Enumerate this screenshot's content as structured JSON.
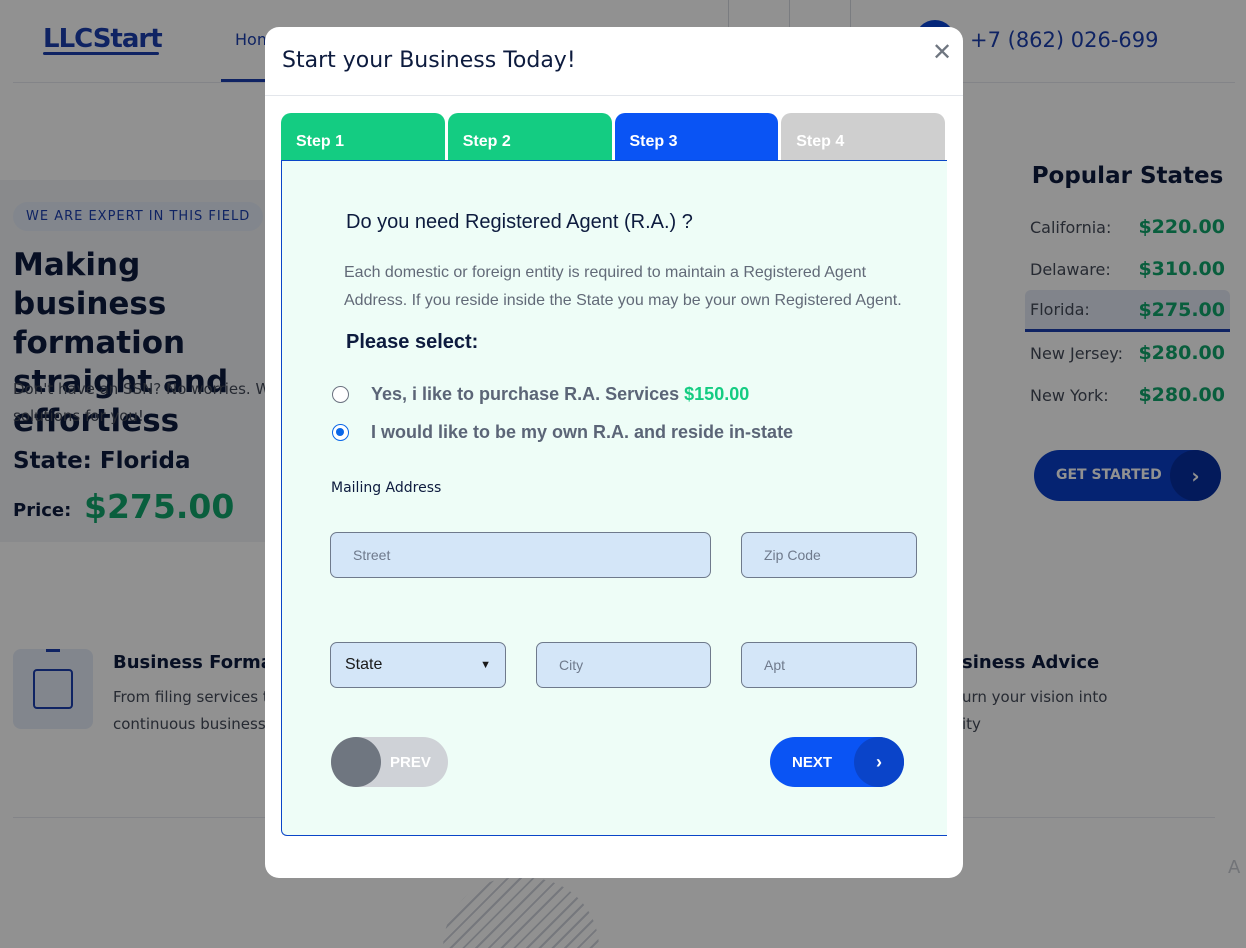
{
  "background": {
    "logo": "LLCStart",
    "nav_home": "Hom",
    "phone": "+7 (862) 026-699",
    "expert_badge": "WE ARE EXPERT IN THIS FIELD",
    "hero_title": "Making business formation straight and effortless",
    "hero_sub": "Don't have an SSN? No worries. W solutions for you!",
    "state_line": "State: Florida",
    "price_label": "Price:",
    "price_value": "$275.00",
    "popular_title": "Popular States",
    "popular_states": [
      {
        "name": "California:",
        "price": "$220.00"
      },
      {
        "name": "Delaware:",
        "price": "$310.00"
      },
      {
        "name": "Florida:",
        "price": "$275.00"
      },
      {
        "name": "New Jersey:",
        "price": "$280.00"
      },
      {
        "name": "New York:",
        "price": "$280.00"
      }
    ],
    "get_started": "GET STARTED",
    "feature1_title": "Business Formatic",
    "feature1_text_line1": "From filing services t",
    "feature1_text_line2": "continuous business",
    "feature2_title": "siness Advice",
    "feature2_text_line1": "urn your vision into",
    "feature2_text_line2": "ity",
    "side_text": "A"
  },
  "modal": {
    "title": "Start your Business Today!",
    "tabs": [
      {
        "label": "Step 1",
        "state": "done"
      },
      {
        "label": "Step 2",
        "state": "done"
      },
      {
        "label": "Step 3",
        "state": "current"
      },
      {
        "label": "Step 4",
        "state": "todo"
      }
    ],
    "question": "Do you need Registered Agent (R.A.) ?",
    "description": "Each domestic or foreign entity is required to maintain a Registered Agent Address. If you reside inside the State you may be your own Registered Agent.",
    "please_select": "Please select:",
    "option_yes": "Yes, i like to purchase R.A. Services",
    "option_yes_price": "$150.00",
    "option_own": "I would like to be my own R.A. and reside in-state",
    "selected_option": "own",
    "mailing_label": "Mailing Address",
    "fields": {
      "street_placeholder": "Street",
      "zip_placeholder": "Zip Code",
      "state_value": "State",
      "city_placeholder": "City",
      "apt_placeholder": "Apt"
    },
    "prev_label": "PREV",
    "next_label": "NEXT"
  },
  "colors": {
    "done_tab": "#14cc82",
    "current_tab": "#0a54f4",
    "todo_tab": "#cfcfcf",
    "accent_green": "#11a56b",
    "brand_blue": "#1b3fae"
  }
}
